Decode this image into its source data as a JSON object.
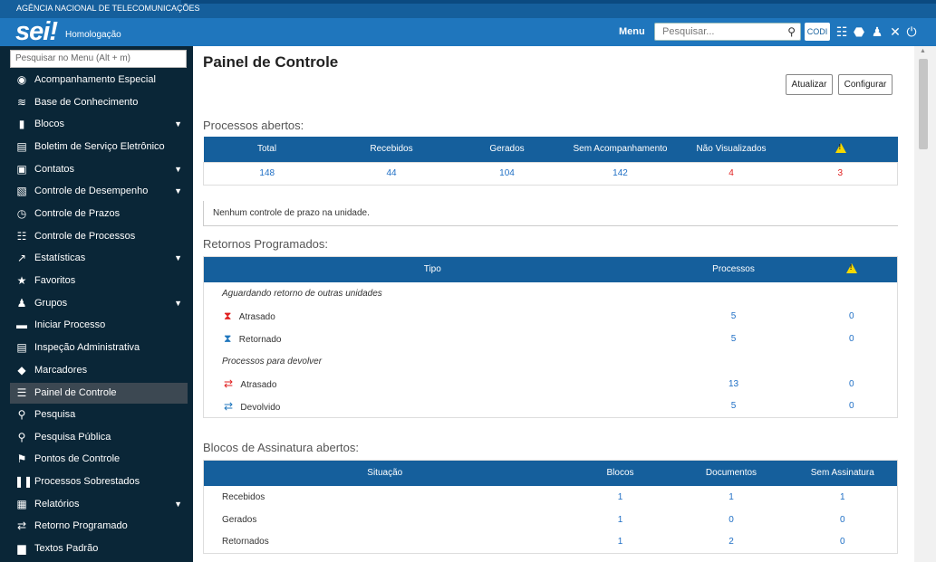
{
  "header": {
    "agency": "AGÊNCIA NACIONAL DE TELECOMUNICAÇÕES",
    "logo": "sei",
    "logo_ex": "!",
    "environment": "Homologação",
    "menu": "Menu",
    "search_placeholder": "Pesquisar...",
    "unit": "CODI"
  },
  "sidebar": {
    "search_placeholder": "Pesquisar no Menu (Alt + m)",
    "items": [
      {
        "label": "Acompanhamento Especial",
        "icon": "eye-icon",
        "glyph": "◉"
      },
      {
        "label": "Base de Conhecimento",
        "icon": "database-icon",
        "glyph": "≋"
      },
      {
        "label": "Blocos",
        "icon": "book-icon",
        "glyph": "▮",
        "caret": "▼"
      },
      {
        "label": "Boletim de Serviço Eletrônico",
        "icon": "newspaper-search-icon",
        "glyph": "▤"
      },
      {
        "label": "Contatos",
        "icon": "contact-card-icon",
        "glyph": "▣",
        "caret": "▼"
      },
      {
        "label": "Controle de Desempenho",
        "icon": "document-chart-icon",
        "glyph": "▧",
        "caret": "▼"
      },
      {
        "label": "Controle de Prazos",
        "icon": "clock-icon",
        "glyph": "◷"
      },
      {
        "label": "Controle de Processos",
        "icon": "list-icon",
        "glyph": "☷"
      },
      {
        "label": "Estatísticas",
        "icon": "line-chart-icon",
        "glyph": "↗",
        "caret": "▼"
      },
      {
        "label": "Favoritos",
        "icon": "star-icon",
        "glyph": "★"
      },
      {
        "label": "Grupos",
        "icon": "users-icon",
        "glyph": "♟",
        "caret": "▼"
      },
      {
        "label": "Iniciar Processo",
        "icon": "folder-icon",
        "glyph": "▬"
      },
      {
        "label": "Inspeção Administrativa",
        "icon": "inspection-icon",
        "glyph": "▤"
      },
      {
        "label": "Marcadores",
        "icon": "tag-icon",
        "glyph": "◆"
      },
      {
        "label": "Painel de Controle",
        "icon": "menu-bars-icon",
        "glyph": "☰"
      },
      {
        "label": "Pesquisa",
        "icon": "search-icon",
        "glyph": "⚲"
      },
      {
        "label": "Pesquisa Pública",
        "icon": "search-public-icon",
        "glyph": "⚲"
      },
      {
        "label": "Pontos de Controle",
        "icon": "flag-icon",
        "glyph": "⚑"
      },
      {
        "label": "Processos Sobrestados",
        "icon": "pause-icon",
        "glyph": "❚❚"
      },
      {
        "label": "Relatórios",
        "icon": "table-icon",
        "glyph": "▦",
        "caret": "▼"
      },
      {
        "label": "Retorno Programado",
        "icon": "exchange-icon",
        "glyph": "⇄"
      },
      {
        "label": "Textos Padrão",
        "icon": "document-icon",
        "glyph": "▆"
      }
    ]
  },
  "main": {
    "title": "Painel de Controle",
    "refresh_label": "Atualizar",
    "configure_label": "Configurar",
    "open_processes": {
      "title": "Processos abertos:",
      "headers": [
        "Total",
        "Recebidos",
        "Gerados",
        "Sem Acompanhamento",
        "Não Visualizados"
      ],
      "values": [
        "148",
        "44",
        "104",
        "142",
        "4",
        "3"
      ]
    },
    "deadline_notice": "Nenhum controle de prazo na unidade.",
    "scheduled_returns": {
      "title": "Retornos Programados:",
      "header_type": "Tipo",
      "header_processes": "Processos",
      "group1": "Aguardando retorno de outras unidades",
      "group2": "Processos para devolver",
      "rows": [
        {
          "label": "Atrasado",
          "processes": "5",
          "warn": "0"
        },
        {
          "label": "Retornado",
          "processes": "5",
          "warn": "0"
        },
        {
          "label": "Atrasado",
          "processes": "13",
          "warn": "0"
        },
        {
          "label": "Devolvido",
          "processes": "5",
          "warn": "0"
        }
      ]
    },
    "signature_blocks": {
      "title": "Blocos de Assinatura abertos:",
      "headers": [
        "Situação",
        "Blocos",
        "Documentos",
        "Sem Assinatura"
      ],
      "rows": [
        {
          "label": "Recebidos",
          "blocks": "1",
          "docs": "1",
          "unsigned": "1"
        },
        {
          "label": "Gerados",
          "blocks": "1",
          "docs": "0",
          "unsigned": "0"
        },
        {
          "label": "Retornados",
          "blocks": "1",
          "docs": "2",
          "unsigned": "0"
        }
      ]
    }
  }
}
